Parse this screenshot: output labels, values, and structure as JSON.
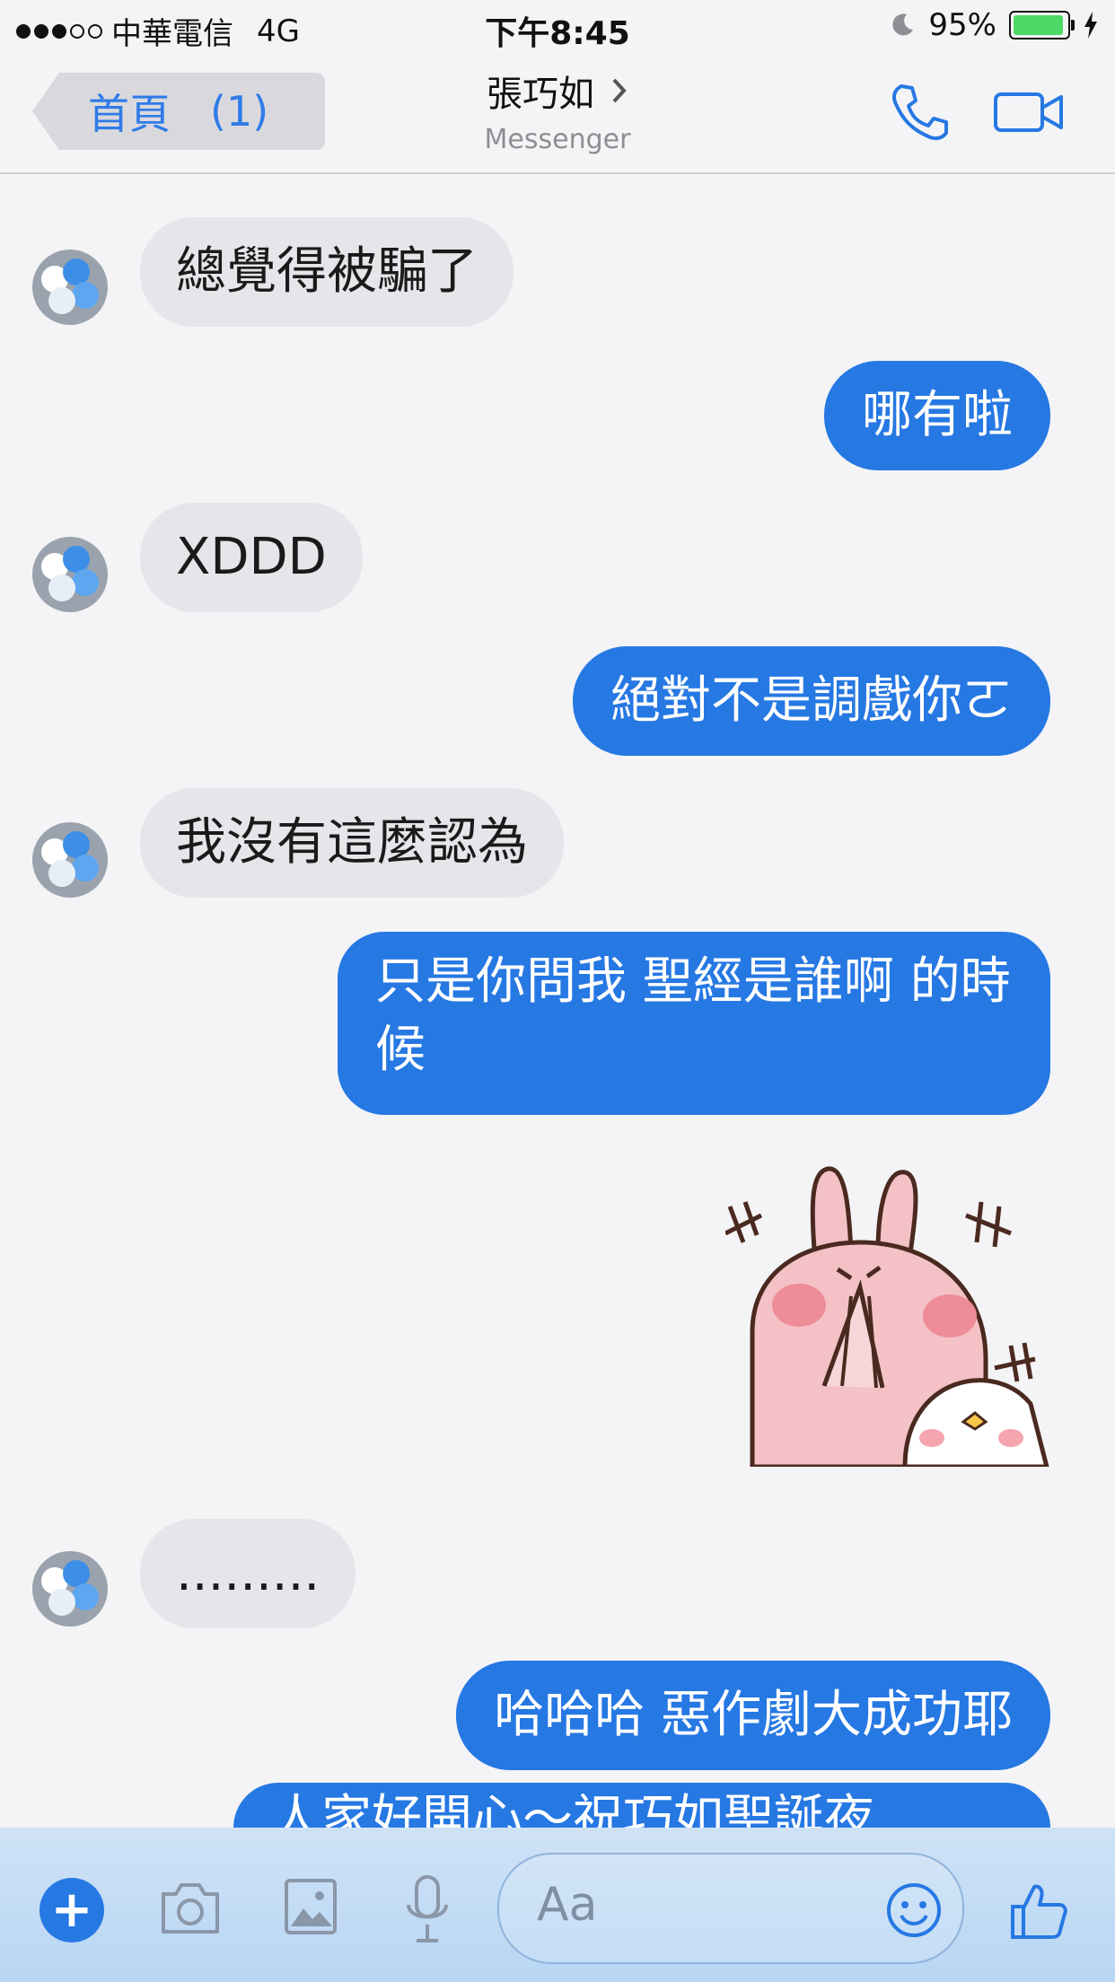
{
  "status_bar": {
    "carrier": "中華電信",
    "network": "4G",
    "time": "下午8:45",
    "battery": "95%",
    "battery_level": 0.95
  },
  "nav": {
    "back_label": "首頁",
    "back_count": "(1)",
    "contact_name": "張巧如",
    "subtitle": "Messenger"
  },
  "messages": [
    {
      "side": "in",
      "text": "總覺得被騙了"
    },
    {
      "side": "out",
      "text": "哪有啦"
    },
    {
      "side": "in",
      "text": "XDDD"
    },
    {
      "side": "out",
      "text": "絕對不是調戲你ㄛ"
    },
    {
      "side": "in",
      "text": "我沒有這麼認為"
    },
    {
      "side": "out",
      "text": "只是你問我 聖經是誰啊 的時候"
    },
    {
      "side": "out",
      "type": "sticker",
      "sticker": "bunny-praying-sticker"
    },
    {
      "side": "in",
      "text": "........."
    },
    {
      "side": "out",
      "text": "哈哈哈 惡作劇大成功耶"
    },
    {
      "side": "out",
      "text": "人家好開心～祝巧如聖誕夜"
    }
  ],
  "composer": {
    "placeholder": "Aa",
    "icons": [
      "plus-icon",
      "camera-icon",
      "image-icon",
      "microphone-icon",
      "emoji-icon",
      "thumbs-up-icon"
    ]
  },
  "colors": {
    "accent": "#2678e3",
    "incoming_bubble": "#e5e5ea",
    "background": "#f4f4f6"
  }
}
